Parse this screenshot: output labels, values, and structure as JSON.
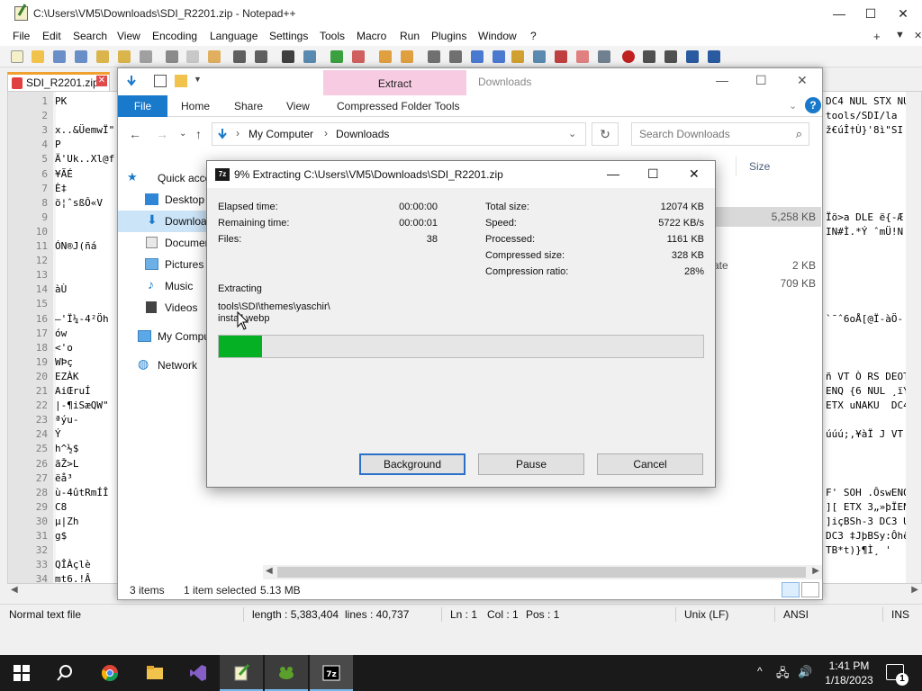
{
  "notepad": {
    "title": "C:\\Users\\VM5\\Downloads\\SDI_R2201.zip - Notepad++",
    "menu": [
      "File",
      "Edit",
      "Search",
      "View",
      "Encoding",
      "Language",
      "Settings",
      "Tools",
      "Macro",
      "Run",
      "Plugins",
      "Window",
      "?"
    ],
    "menu_right": [
      "+",
      "▼",
      "✕"
    ],
    "tab_label": "SDI_R2201.zip",
    "line_numbers": [
      "1",
      "2",
      "3",
      "4",
      "5",
      "6",
      "7",
      "8",
      "9",
      "10",
      "11",
      "12",
      "13",
      "14",
      "15",
      "16",
      "17",
      "18",
      "19",
      "20",
      "21",
      "22",
      "23",
      "24",
      "25",
      "26",
      "27",
      "28",
      "29",
      "30",
      "31",
      "32",
      "33",
      "34"
    ],
    "code_left": [
      "PK",
      "",
      "x..&ÜemwÏ\"",
      "P",
      "Ä'Uk..Xl@f",
      "¥ÃÉ",
      "È‡",
      "ö¦ˆsßÔ«V",
      "",
      "",
      "ÓN®J(ñá",
      "",
      "",
      "àÙ",
      "",
      "—'Ï¼-4²Öh",
      "ów",
      "<'o",
      "WÞç",
      "EZÀK",
      "AiŒruÍ",
      "|-¶iSæQW\"",
      "ªýu-",
      "Ý",
      "h^½$",
      "ãŽ>L",
      "ëå³",
      "ù-4ûtRmÍÎ",
      "C8",
      "µ|Zh",
      "g$",
      "",
      "QÎÀçlè",
      "mt6.!Â"
    ],
    "code_right": [
      "DC4 NUL STX NU",
      "tools/SDI/la",
      "ž€úÎ†Ù}'8ì\"SI",
      "",
      "",
      "",
      "",
      "",
      "Ïö>a DLE ë{-Æ",
      "IN#Ì.*Ý ˆmÜ!N",
      "",
      "",
      "",
      "",
      "",
      "`¯ˆ6oÅ[@Ï-àÖ-",
      "",
      "",
      "",
      "ñ VT Ò RS DEOT P",
      "ENQ {6 NUL ¸ïÝ¿",
      "ETX uNAKU  DC4",
      "",
      "úúú;,¥àÏ J VT ZI",
      "",
      "",
      "",
      "F' SOH .ÔswENQ",
      "][ ETX 3„»þÏENO",
      "]içBSh-3 DC3 U",
      "DC3 ‡JþBSy:Ôhê",
      "TB*t)}¶Ì¸ '",
      "",
      ""
    ],
    "status": {
      "type": "Normal text file",
      "length": "length : 5,383,404",
      "lines": "lines : 40,737",
      "ln": "Ln : 1",
      "col": "Col : 1",
      "pos": "Pos : 1",
      "eol": "Unix (LF)",
      "encoding": "ANSI",
      "mode": "INS"
    }
  },
  "explorer": {
    "context_tab": "Extract",
    "window_title": "Downloads",
    "ribbon_tabs": {
      "file": "File",
      "home": "Home",
      "share": "Share",
      "view": "View",
      "compressed": "Compressed Folder Tools"
    },
    "address": [
      "My Computer",
      "Downloads"
    ],
    "search_placeholder": "Search Downloads",
    "nav": [
      "Quick access",
      "Desktop",
      "Downloads",
      "Documents",
      "Pictures",
      "Music",
      "Videos",
      "My Computer",
      "Network"
    ],
    "column_size": "Size",
    "files": [
      {
        "date": "",
        "size": "5,258 KB",
        "selected": true
      },
      {
        "date": "ate",
        "size": "2 KB",
        "selected": false
      },
      {
        "date": "",
        "size": "709 KB",
        "selected": false
      }
    ],
    "status": {
      "items": "3 items",
      "selected": "1 item selected",
      "size": "5.13 MB"
    }
  },
  "zip": {
    "title": "9% Extracting C:\\Users\\VM5\\Downloads\\SDI_R2201.zip",
    "icon_text": "7z",
    "left": [
      {
        "label": "Elapsed time:",
        "value": "00:00:00"
      },
      {
        "label": "Remaining time:",
        "value": "00:00:01"
      },
      {
        "label": "Files:",
        "value": "38"
      }
    ],
    "right": [
      {
        "label": "Total size:",
        "value": "12074 KB"
      },
      {
        "label": "Speed:",
        "value": "5722 KB/s"
      },
      {
        "label": "Processed:",
        "value": "1161 KB"
      },
      {
        "label": "Compressed size:",
        "value": "328 KB"
      },
      {
        "label": "Compression ratio:",
        "value": "28%"
      }
    ],
    "extracting_label": "Extracting",
    "current_file_line1": "tools\\SDI\\themes\\yaschir\\",
    "current_file_line2": "install.webp",
    "progress_fraction": 0.09,
    "buttons": {
      "background": "Background",
      "pause": "Pause",
      "cancel": "Cancel"
    }
  },
  "taskbar": {
    "apps": [
      "start",
      "search",
      "chrome",
      "file-explorer",
      "visual-studio",
      "notepad-plus-plus",
      "game-app",
      "7zip"
    ],
    "tray_glyphs": [
      "^",
      "🖧",
      "🔊"
    ],
    "clock_time": "1:41 PM",
    "clock_date": "1/18/2023",
    "notification_count": "1"
  },
  "colors": {
    "accent": "#1979ca",
    "progress": "#06b025",
    "taskbar": "#1a1a1a",
    "context_tab": "#f7cce3"
  }
}
